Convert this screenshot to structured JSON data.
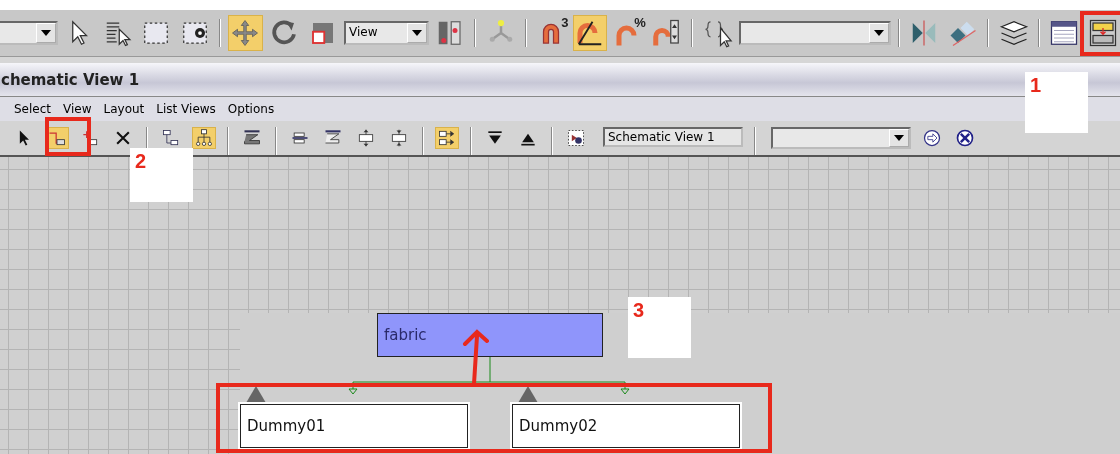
{
  "main_toolbar": [
    {
      "kind": "dropdown"
    },
    {
      "kind": "tool",
      "pressed": false
    },
    {
      "kind": "tool",
      "pressed": false
    },
    {
      "kind": "tool",
      "pressed": false
    },
    {
      "kind": "tool",
      "pressed": false
    },
    {
      "kind": "separator"
    },
    {
      "kind": "tool",
      "pressed": true
    },
    {
      "kind": "tool",
      "pressed": false
    },
    {
      "kind": "tool",
      "pressed": false
    },
    {
      "kind": "dropdown",
      "value": "View"
    },
    {
      "kind": "tool",
      "pressed": false
    },
    {
      "kind": "separator"
    },
    {
      "kind": "tool",
      "pressed": false
    },
    {
      "kind": "separator"
    },
    {
      "kind": "tool",
      "pressed": false,
      "text": "3"
    },
    {
      "kind": "tool",
      "pressed": true
    },
    {
      "kind": "tool",
      "pressed": false,
      "text": "%"
    },
    {
      "kind": "tool",
      "pressed": false
    },
    {
      "kind": "separator"
    },
    {
      "kind": "tool",
      "pressed": false
    },
    {
      "kind": "dropdown"
    },
    {
      "kind": "separator"
    },
    {
      "kind": "tool",
      "pressed": false
    },
    {
      "kind": "tool",
      "pressed": false
    },
    {
      "kind": "separator"
    },
    {
      "kind": "tool",
      "pressed": false
    },
    {
      "kind": "separator"
    },
    {
      "kind": "tool",
      "pressed": false
    },
    {
      "kind": "tool",
      "pressed": false
    }
  ],
  "window": {
    "title": "chematic View 1"
  },
  "menu": [
    "Select",
    "View",
    "Layout",
    "List Views",
    "Options"
  ],
  "schematic_toolbar": [
    {
      "kind": "tool",
      "pressed": false
    },
    {
      "kind": "tool",
      "pressed": true
    },
    {
      "kind": "tool",
      "pressed": false
    },
    {
      "kind": "tool",
      "pressed": false
    },
    {
      "kind": "separator"
    },
    {
      "kind": "tool",
      "pressed": false
    },
    {
      "kind": "tool",
      "pressed": true
    },
    {
      "kind": "separator"
    },
    {
      "kind": "tool",
      "pressed": false
    },
    {
      "kind": "separator"
    },
    {
      "kind": "tool",
      "pressed": false
    },
    {
      "kind": "tool",
      "pressed": false
    },
    {
      "kind": "tool",
      "pressed": false
    },
    {
      "kind": "tool",
      "pressed": false
    },
    {
      "kind": "separator"
    },
    {
      "kind": "tool",
      "pressed": true
    },
    {
      "kind": "separator"
    },
    {
      "kind": "tool",
      "pressed": false
    },
    {
      "kind": "tool",
      "pressed": false
    },
    {
      "kind": "separator"
    },
    {
      "kind": "tool",
      "pressed": false
    },
    {
      "kind": "textfield",
      "value": "Schematic View 1"
    },
    {
      "kind": "separator"
    },
    {
      "kind": "dropdown"
    },
    {
      "kind": "tool",
      "pressed": false
    },
    {
      "kind": "tool",
      "pressed": false
    }
  ],
  "nodes": [
    {
      "label": "fabric",
      "selected": true
    },
    {
      "label": "Dummy01",
      "selected": false
    },
    {
      "label": "Dummy02",
      "selected": false
    }
  ],
  "annotations": [
    {
      "label": "1"
    },
    {
      "label": "2"
    },
    {
      "label": "3"
    }
  ]
}
